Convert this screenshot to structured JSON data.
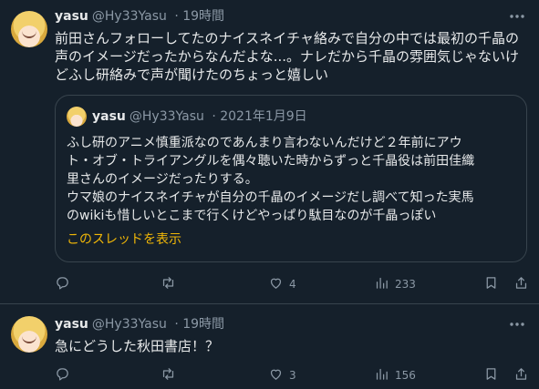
{
  "tweets": [
    {
      "name": "yasu",
      "handle": "@Hy33Yasu",
      "time": "· 19時間",
      "text_lines": [
        "前田さんフォローしてたのナイスネイチャ絡みで自分の中では最初の千晶の",
        "声のイメージだったからなんだよな...。ナレだから千晶の雰囲気じゃないけ",
        "どふし研絡みで声が聞けたのちょっと嬉しい"
      ],
      "quote": {
        "name": "yasu",
        "handle": "@Hy33Yasu",
        "date": "· 2021年1月9日",
        "text_lines": [
          "ふし研のアニメ慎重派なのであんまり言わないんだけど２年前にアウ",
          "ト・オブ・トライアングルを偶々聴いた時からずっと千晶役は前田佳織",
          "里さんのイメージだったりする。",
          "ウマ娘のナイスネイチャが自分の千晶のイメージだし調べて知った実馬",
          "のwikiも惜しいとこまで行くけどやっぱり駄目なのが千晶っぽい"
        ],
        "thread_link": "このスレッドを表示"
      },
      "actions": {
        "reply": "",
        "retweet": "",
        "like": "4",
        "views": "233"
      }
    },
    {
      "name": "yasu",
      "handle": "@Hy33Yasu",
      "time": "· 19時間",
      "text_lines": [
        "急にどうした秋田書店！？"
      ],
      "actions": {
        "reply": "",
        "retweet": "",
        "like": "3",
        "views": "156"
      }
    }
  ],
  "icons": {
    "more": "more-icon",
    "reply": "reply-icon",
    "retweet": "retweet-icon",
    "like": "heart-icon",
    "views": "views-icon",
    "bookmark": "bookmark-icon",
    "share": "share-icon"
  },
  "colors": {
    "background": "#15202b",
    "text": "#e7e9ea",
    "secondary": "#8b98a5",
    "border": "#38444d",
    "link": "#f2b807"
  }
}
